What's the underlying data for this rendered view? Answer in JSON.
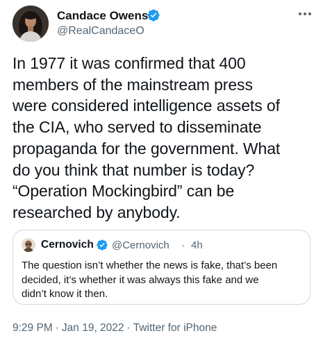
{
  "author": {
    "name": "Candace Owens",
    "handle": "@RealCandaceO"
  },
  "tweet": {
    "text_lines": [
      "In 1977 it was confirmed that 400",
      "members of the mainstream press",
      "were considered intelligence assets of",
      "the CIA, who served to disseminate",
      "propaganda for the government. What",
      "do you think that number is today?",
      "“Operation Mockingbird” can be",
      "researched by anybody."
    ]
  },
  "quoted": {
    "name": "Cernovich",
    "handle": "@Cernovich",
    "separator": "·",
    "time": "4h",
    "text_lines": [
      "The question isn’t whether the news is fake, that’s been",
      "decided, it’s whether it was always this fake and we",
      "didn’t know it then."
    ]
  },
  "meta": {
    "time": "9:29 PM",
    "separator": "·",
    "date": "Jan 19, 2022",
    "source": "Twitter for iPhone"
  },
  "colors": {
    "verified": "#1d9bf0",
    "secondary_text": "#536471",
    "primary_text": "#0f1419",
    "border": "#cfd9de"
  },
  "icons": {
    "verified": "verified-badge-icon",
    "more": "more-horizontal-icon"
  }
}
